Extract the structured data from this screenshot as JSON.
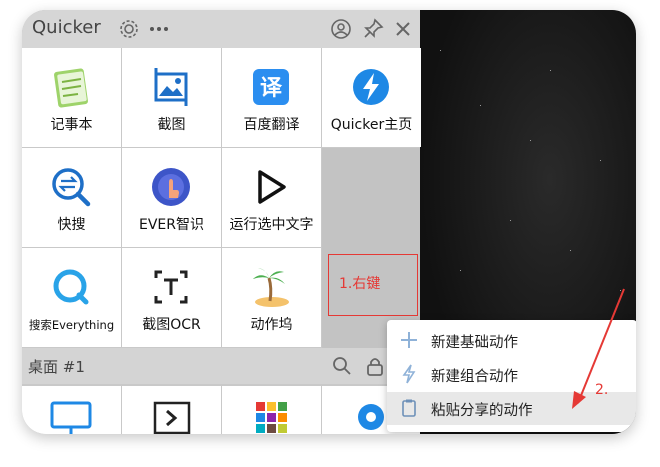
{
  "window": {
    "title": "Quicker",
    "icons": [
      "gear-icon",
      "more-icon",
      "user-icon",
      "pin-icon",
      "close-icon"
    ]
  },
  "actions": [
    {
      "label": "记事本",
      "icon": "notepad-icon"
    },
    {
      "label": "截图",
      "icon": "screenshot-icon"
    },
    {
      "label": "百度翻译",
      "icon": "translate-icon"
    },
    {
      "label": "Quicker主页",
      "icon": "quicker-home-icon"
    },
    {
      "label": "快搜",
      "icon": "quick-search-icon"
    },
    {
      "label": "EVER智识",
      "icon": "ever-icon"
    },
    {
      "label": "运行选中文字",
      "icon": "run-text-icon"
    },
    {
      "label": "搜索Everything",
      "icon": "everything-search-icon"
    },
    {
      "label": "截图OCR",
      "icon": "ocr-icon"
    },
    {
      "label": "动作坞",
      "icon": "palm-tree-icon"
    }
  ],
  "desktop_bar": {
    "label": "桌面 #1"
  },
  "annotation": {
    "step1": "1.右键",
    "step2": "2."
  },
  "context_menu": [
    {
      "label": "新建基础动作",
      "icon": "plus-icon"
    },
    {
      "label": "新建组合动作",
      "icon": "lightning-icon"
    },
    {
      "label": "粘贴分享的动作",
      "icon": "clipboard-icon"
    }
  ],
  "colors": {
    "accent": "#1e88e5",
    "annotation": "#e53935"
  }
}
